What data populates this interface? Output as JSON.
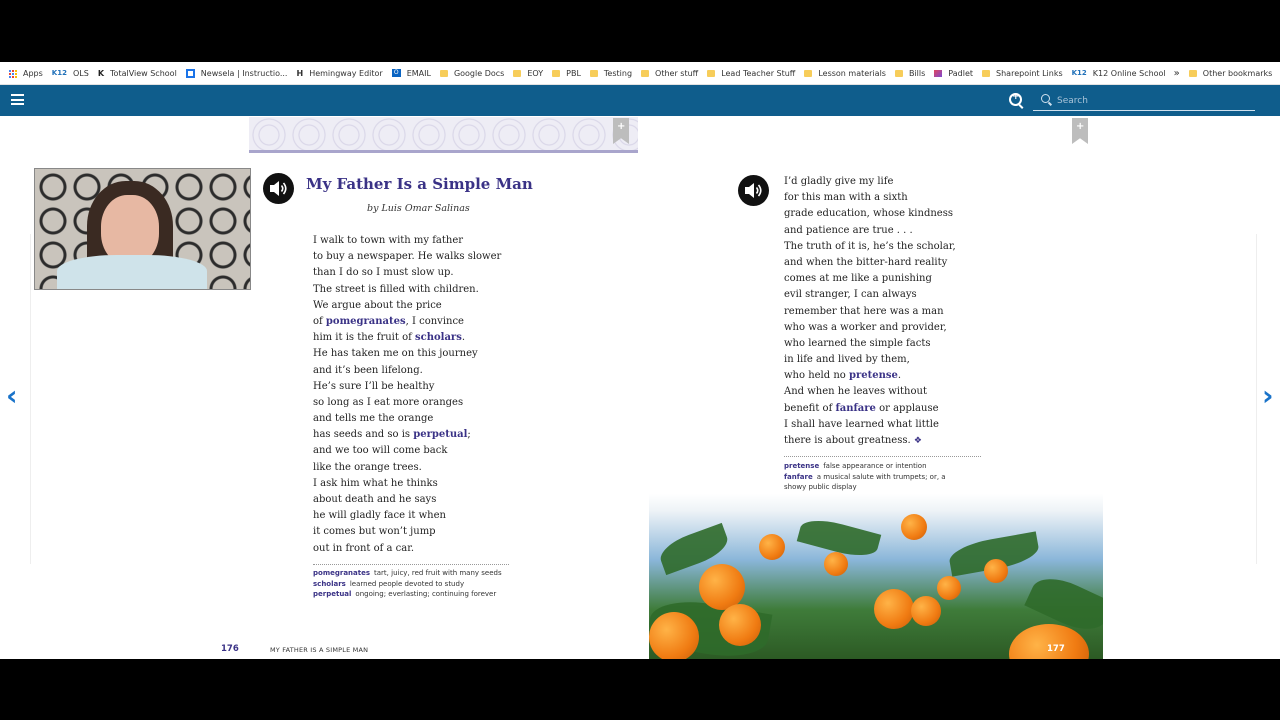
{
  "bookmarks": [
    {
      "label": "Apps",
      "icon": "apps-grid-icon"
    },
    {
      "label": "OLS",
      "icon": "k12-icon"
    },
    {
      "label": "TotalView School",
      "icon": "totalview-icon"
    },
    {
      "label": "Newsela | Instructio...",
      "icon": "newsela-icon"
    },
    {
      "label": "Hemingway Editor",
      "icon": "hemingway-icon"
    },
    {
      "label": "EMAIL",
      "icon": "outlook-icon"
    },
    {
      "label": "Google Docs",
      "icon": "folder-icon"
    },
    {
      "label": "EOY",
      "icon": "folder-icon"
    },
    {
      "label": "PBL",
      "icon": "folder-icon"
    },
    {
      "label": "Testing",
      "icon": "folder-icon"
    },
    {
      "label": "Other stuff",
      "icon": "folder-icon"
    },
    {
      "label": "Lead Teacher Stuff",
      "icon": "folder-icon"
    },
    {
      "label": "Lesson materials",
      "icon": "folder-icon"
    },
    {
      "label": "Bills",
      "icon": "folder-icon"
    },
    {
      "label": "Padlet",
      "icon": "padlet-icon"
    },
    {
      "label": "Sharepoint Links",
      "icon": "folder-icon"
    },
    {
      "label": "K12 Online School",
      "icon": "k12-icon"
    }
  ],
  "bookmarks_overflow": "»",
  "other_bookmarks": "Other bookmarks",
  "toolbar": {
    "search_placeholder": "Search"
  },
  "left_page": {
    "title": "My Father Is a Simple Man",
    "byline": "by Luis Omar Salinas",
    "lines": [
      [
        {
          "t": "I walk to town with my father"
        }
      ],
      [
        {
          "t": "to buy a newspaper. He walks slower"
        }
      ],
      [
        {
          "t": "than I do so I must slow up."
        }
      ],
      [
        {
          "t": "The street is filled with children."
        }
      ],
      [
        {
          "t": "We argue about the price"
        }
      ],
      [
        {
          "t": "of "
        },
        {
          "t": "pomegranates",
          "v": true
        },
        {
          "t": ", I convince"
        }
      ],
      [
        {
          "t": "him it is the fruit of "
        },
        {
          "t": "scholars",
          "v": true
        },
        {
          "t": "."
        }
      ],
      [
        {
          "t": "He has taken me on this journey"
        }
      ],
      [
        {
          "t": "and it’s been lifelong."
        }
      ],
      [
        {
          "t": "He’s sure I’ll be healthy"
        }
      ],
      [
        {
          "t": "so long as I eat more oranges"
        }
      ],
      [
        {
          "t": "and tells me the orange"
        }
      ],
      [
        {
          "t": "has seeds and so is "
        },
        {
          "t": "perpetual",
          "v": true
        },
        {
          "t": ";"
        }
      ],
      [
        {
          "t": "and we too will come back"
        }
      ],
      [
        {
          "t": "like the orange trees."
        }
      ],
      [
        {
          "t": "I ask him what he thinks"
        }
      ],
      [
        {
          "t": "about death and he says"
        }
      ],
      [
        {
          "t": "he will gladly face it when"
        }
      ],
      [
        {
          "t": "it comes but won’t jump"
        }
      ],
      [
        {
          "t": "out in front of a car."
        }
      ]
    ],
    "glossary": [
      {
        "term": "pomegranates",
        "def": "tart, juicy, red fruit with many seeds"
      },
      {
        "term": "scholars",
        "def": "learned people devoted to study"
      },
      {
        "term": "perpetual",
        "def": "ongoing; everlasting; continuing forever"
      }
    ],
    "page_number": "176",
    "running_head": "MY FATHER IS A SIMPLE MAN"
  },
  "right_page": {
    "lines": [
      [
        {
          "t": "I’d gladly give my life"
        }
      ],
      [
        {
          "t": "for this man with a sixth"
        }
      ],
      [
        {
          "t": "grade education, whose kindness"
        }
      ],
      [
        {
          "t": "and patience are true . . ."
        }
      ],
      [
        {
          "t": "The truth of it is, he’s the scholar,"
        }
      ],
      [
        {
          "t": "and when the bitter-hard reality"
        }
      ],
      [
        {
          "t": "comes at me like a punishing"
        }
      ],
      [
        {
          "t": "evil stranger, I can always"
        }
      ],
      [
        {
          "t": "remember that here was a man"
        }
      ],
      [
        {
          "t": "who was a worker and provider,"
        }
      ],
      [
        {
          "t": "who learned the simple facts"
        }
      ],
      [
        {
          "t": "in life and lived by them,"
        }
      ],
      [
        {
          "t": "who held no "
        },
        {
          "t": "pretense",
          "v": true
        },
        {
          "t": "."
        }
      ],
      [
        {
          "t": "And when he leaves without"
        }
      ],
      [
        {
          "t": "benefit of "
        },
        {
          "t": "fanfare",
          "v": true
        },
        {
          "t": " or applause"
        }
      ],
      [
        {
          "t": "I shall have learned what little"
        }
      ],
      [
        {
          "t": "there is about greatness. "
        },
        {
          "t": "❖",
          "end": true
        }
      ]
    ],
    "glossary": [
      {
        "term": "pretense",
        "def": "false appearance or intention"
      },
      {
        "term": "fanfare",
        "def": "a musical salute with trumpets; or, a showy public display"
      }
    ],
    "page_number": "177"
  },
  "colors": {
    "accent_purple": "#3a3286",
    "toolbar_blue": "#0f5d8c",
    "nav_arrow_blue": "#1a73c9"
  }
}
